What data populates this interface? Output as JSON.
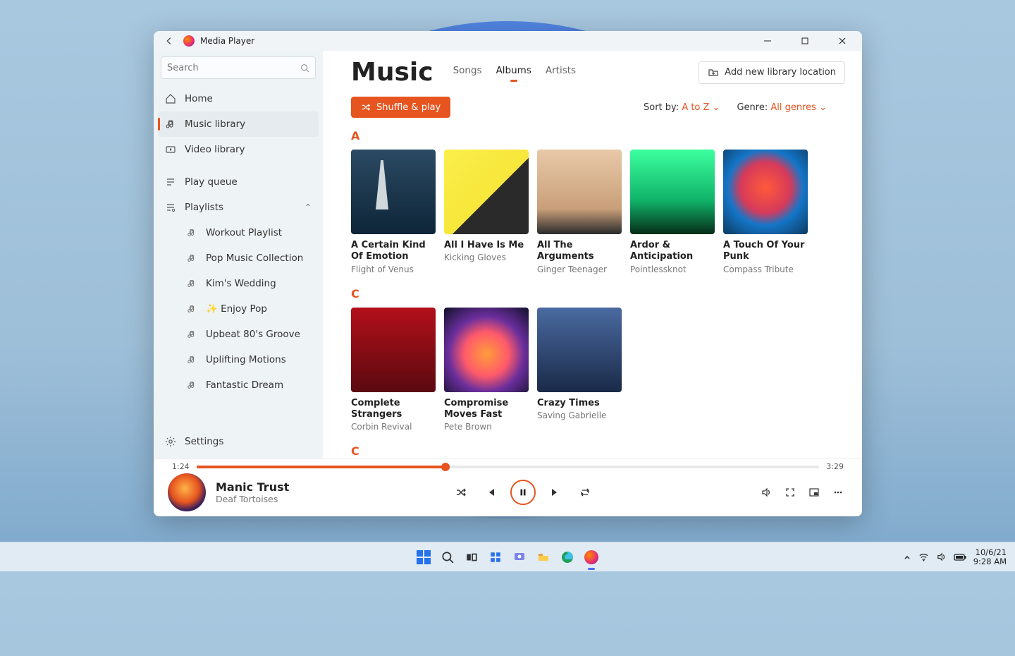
{
  "app": {
    "title": "Media Player"
  },
  "search": {
    "placeholder": "Search"
  },
  "nav": {
    "home": "Home",
    "music": "Music library",
    "video": "Video library",
    "queue": "Play queue",
    "playlists": "Playlists",
    "items": [
      "Workout Playlist",
      "Pop Music Collection",
      "Kim's Wedding",
      "✨ Enjoy Pop",
      "Upbeat 80's Groove",
      "Uplifting Motions",
      "Fantastic Dream"
    ],
    "settings": "Settings"
  },
  "page": {
    "title": "Music",
    "tabs": {
      "songs": "Songs",
      "albums": "Albums",
      "artists": "Artists"
    },
    "add_location": "Add new library location",
    "shuffle": "Shuffle & play",
    "sort_label": "Sort by:",
    "sort_value": "A to Z",
    "genre_label": "Genre:",
    "genre_value": "All genres"
  },
  "sections": [
    {
      "letter": "A",
      "albums": [
        {
          "title": "A Certain Kind Of Emotion",
          "artist": "Flight of Venus"
        },
        {
          "title": "All I Have Is Me",
          "artist": "Kicking Gloves"
        },
        {
          "title": "All The Arguments",
          "artist": "Ginger Teenager"
        },
        {
          "title": "Ardor & Anticipation",
          "artist": "Pointlessknot"
        },
        {
          "title": "A Touch Of Your Punk",
          "artist": "Compass Tribute"
        }
      ]
    },
    {
      "letter": "C",
      "albums": [
        {
          "title": "Complete Strangers",
          "artist": "Corbin Revival"
        },
        {
          "title": "Compromise Moves Fast",
          "artist": "Pete Brown"
        },
        {
          "title": "Crazy Times",
          "artist": "Saving Gabrielle"
        }
      ]
    },
    {
      "letter": "C",
      "albums": []
    }
  ],
  "player": {
    "elapsed": "1:24",
    "duration": "3:29",
    "title": "Manic Trust",
    "artist": "Deaf Tortoises"
  },
  "tray": {
    "date": "10/6/21",
    "time": "9:28 AM"
  }
}
